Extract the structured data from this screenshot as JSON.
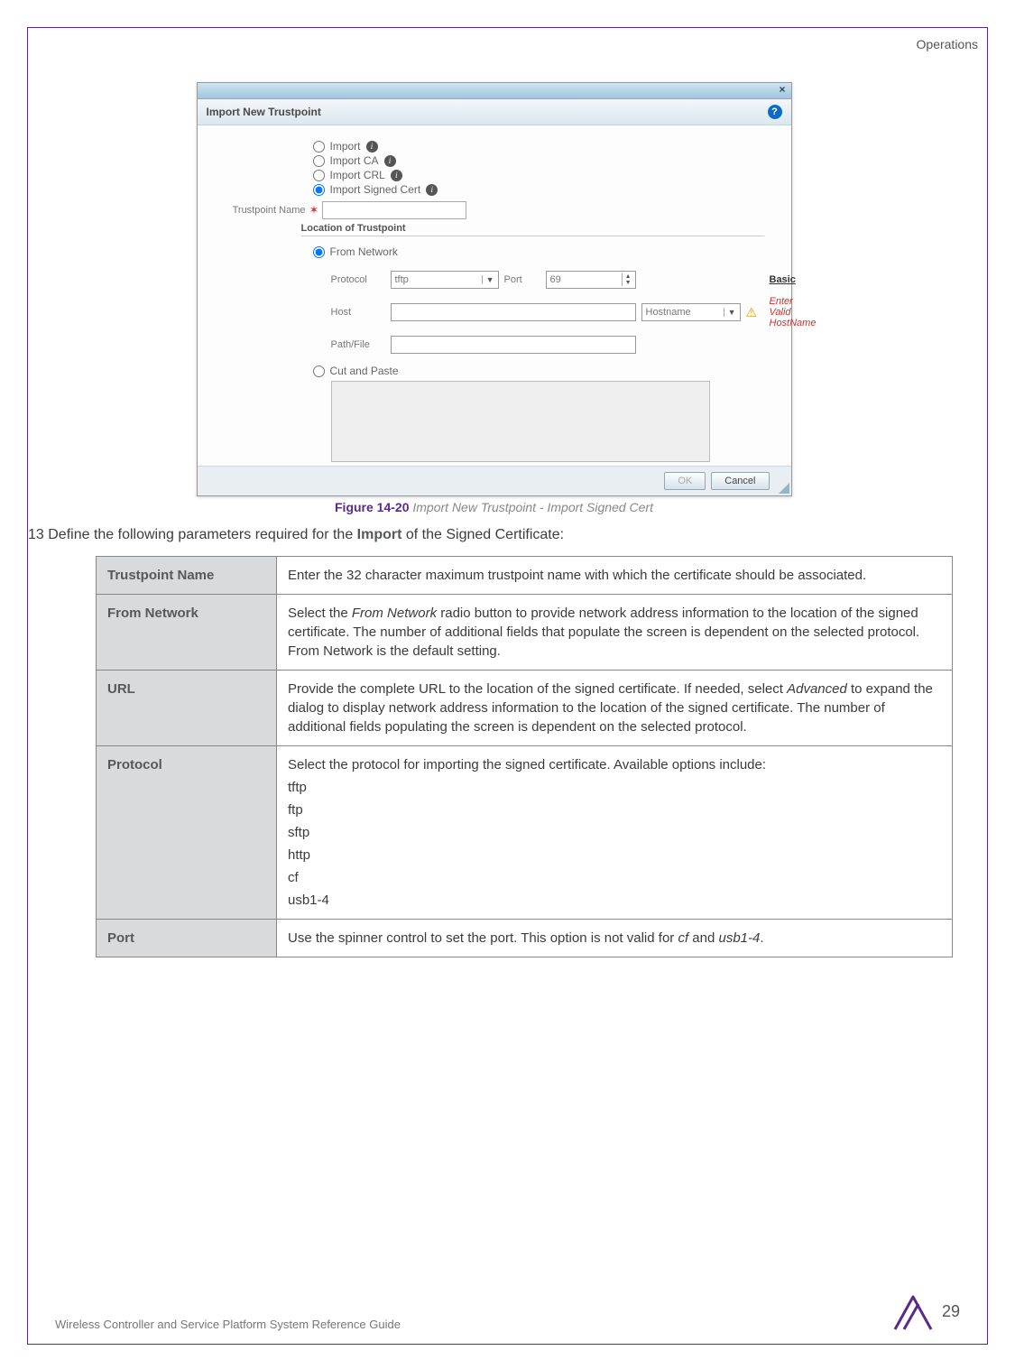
{
  "header": {
    "section": "Operations"
  },
  "dialog": {
    "title": "Import New Trustpoint",
    "radios": {
      "import": "Import",
      "import_ca": "Import CA",
      "import_crl": "Import CRL",
      "import_signed": "Import Signed Cert"
    },
    "trustpoint_label": "Trustpoint Name",
    "fieldset_title": "Location of Trustpoint",
    "from_network_label": "From Network",
    "protocol_label": "Protocol",
    "protocol_value": "tftp",
    "port_label": "Port",
    "port_value": "69",
    "basic_link": "Basic",
    "host_label": "Host",
    "host_combo": "Hostname",
    "host_error": "Enter Valid HostName",
    "path_label": "Path/File",
    "cut_paste_label": "Cut and Paste",
    "ok_btn": "OK",
    "cancel_btn": "Cancel"
  },
  "figure": {
    "num": "Figure 14-20",
    "title": "Import New Trustpoint - Import Signed Cert"
  },
  "step": {
    "num": "13",
    "text_a": "Define the following parameters required for the ",
    "text_b": "Import",
    "text_c": " of the Signed Certificate:"
  },
  "table": {
    "rows": [
      {
        "key": "Trustpoint Name",
        "val_plain": "Enter the 32 character maximum trustpoint name with which the certificate should be associated."
      },
      {
        "key": "From Network",
        "val_html": "Select the <em>From Network</em> radio button to provide network address information to the location of the signed certificate. The number of additional fields that populate the screen is dependent on the selected protocol. From Network is the default setting."
      },
      {
        "key": "URL",
        "val_html": "Provide the complete URL to the location of the signed certificate. If needed, select <em>Advanced</em> to expand the dialog to display network address information to the location of the signed certificate. The number of additional fields populating the screen is dependent on the selected protocol."
      },
      {
        "key": "Protocol",
        "val_intro": "Select the protocol for importing the signed certificate. Available options include:",
        "list": [
          "tftp",
          "ftp",
          "sftp",
          "http",
          "cf",
          "usb1-4"
        ]
      },
      {
        "key": "Port",
        "val_html": "Use the spinner control to set the port. This option is not valid for <em>cf</em> and <em>usb1-4</em>."
      }
    ]
  },
  "footer": {
    "text": "Wireless Controller and Service Platform System Reference Guide",
    "page": "29"
  }
}
